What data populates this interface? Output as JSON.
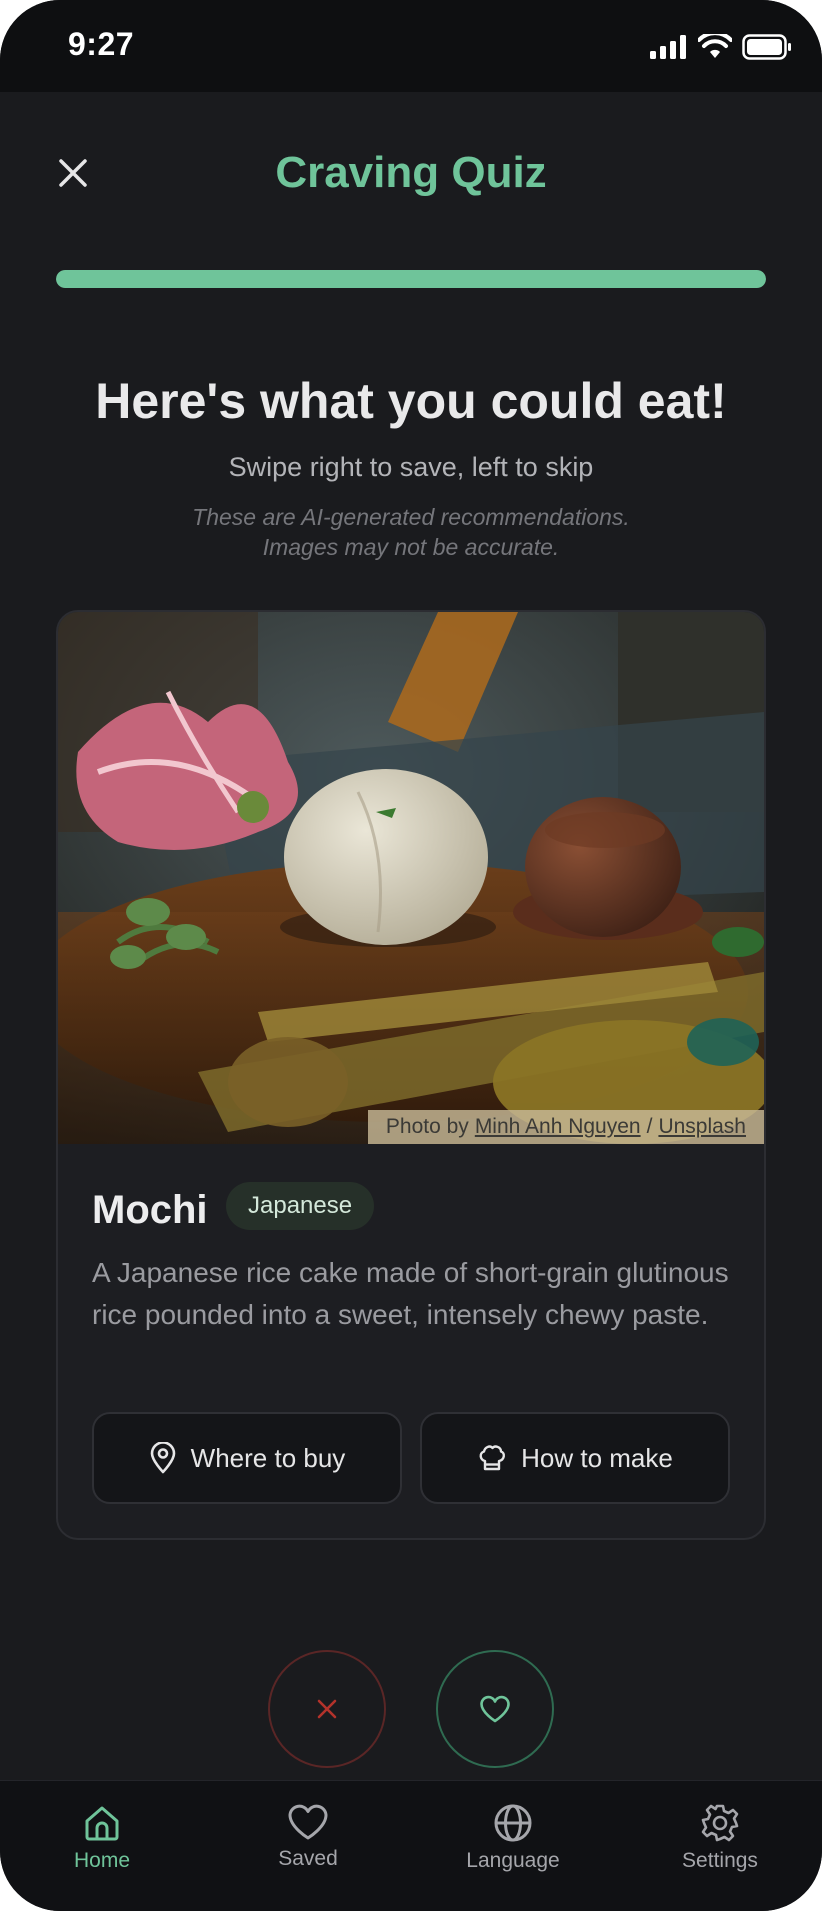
{
  "status_bar": {
    "time": "9:27"
  },
  "header": {
    "title": "Craving Quiz",
    "progress": 1.0
  },
  "intro": {
    "headline": "Here's what you could eat!",
    "subline": "Swipe right to save, left to skip",
    "disclaimer_line1": "These are AI-generated recommendations.",
    "disclaimer_line2": "Images may not be accurate."
  },
  "card": {
    "photo_credit": {
      "prefix": "Photo by",
      "author": "Minh Anh Nguyen",
      "separator": "/",
      "source": "Unsplash"
    },
    "name": "Mochi",
    "cuisine": "Japanese",
    "description": "A Japanese rice cake made of short-grain glutinous rice pounded into a sweet, intensely chewy paste.",
    "buy_label": "Where to buy",
    "make_label": "How to make"
  },
  "tabs": [
    {
      "label": "Home",
      "icon": "home-icon",
      "active": true
    },
    {
      "label": "Saved",
      "icon": "heart-icon",
      "active": false
    },
    {
      "label": "Language",
      "icon": "globe-icon",
      "active": false
    },
    {
      "label": "Settings",
      "icon": "gear-icon",
      "active": false
    }
  ],
  "colors": {
    "accent": "#6fc49a",
    "background": "#1a1b1e",
    "skip": "#c0392b"
  }
}
